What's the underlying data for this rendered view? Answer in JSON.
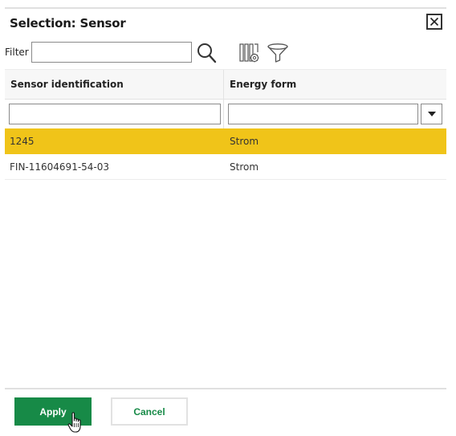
{
  "dialog": {
    "title": "Selection: Sensor",
    "close_icon": "close-icon"
  },
  "toolbar": {
    "filter_label": "Filter",
    "filter_value": "",
    "search_icon": "search-icon",
    "column_settings_icon": "column-settings-icon",
    "funnel_icon": "funnel-icon"
  },
  "grid": {
    "columns": [
      {
        "label": "Sensor identification",
        "filter_value": ""
      },
      {
        "label": "Energy form",
        "filter_value": ""
      }
    ],
    "rows": [
      {
        "sensor_id": "1245",
        "energy_form": "Strom",
        "selected": true
      },
      {
        "sensor_id": "FIN-11604691-54-03",
        "energy_form": "Strom",
        "selected": false
      }
    ],
    "selected_color": "#f0c419"
  },
  "footer": {
    "apply_label": "Apply",
    "cancel_label": "Cancel",
    "accent_color": "#178a47"
  }
}
